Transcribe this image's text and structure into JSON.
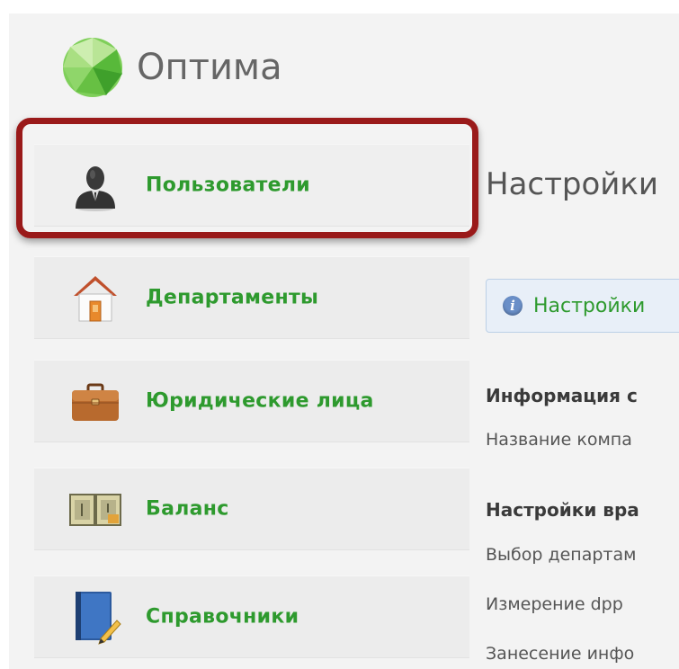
{
  "brand": {
    "title": "Оптима"
  },
  "sidebar": {
    "items": [
      {
        "label": "Пользователи",
        "icon": "user-icon",
        "active": true
      },
      {
        "label": "Департаменты",
        "icon": "house-icon"
      },
      {
        "label": "Юридические лица",
        "icon": "briefcase-icon"
      },
      {
        "label": "Баланс",
        "icon": "cash-register-icon"
      },
      {
        "label": "Справочники",
        "icon": "notebook-pencil-icon"
      }
    ]
  },
  "main": {
    "title": "Настройки",
    "info_bar": {
      "text": "Настройки"
    },
    "sections": [
      {
        "heading": "Информация с",
        "fields": [
          "Название компа"
        ]
      },
      {
        "heading": "Настройки вра",
        "fields": [
          "Выбор департам",
          "Измерение dpp",
          "Занесение инфо"
        ]
      }
    ]
  },
  "colors": {
    "nav_label": "#2e9a2e",
    "highlight_border": "#9a1a1a",
    "info_bg": "#e8eff8"
  }
}
